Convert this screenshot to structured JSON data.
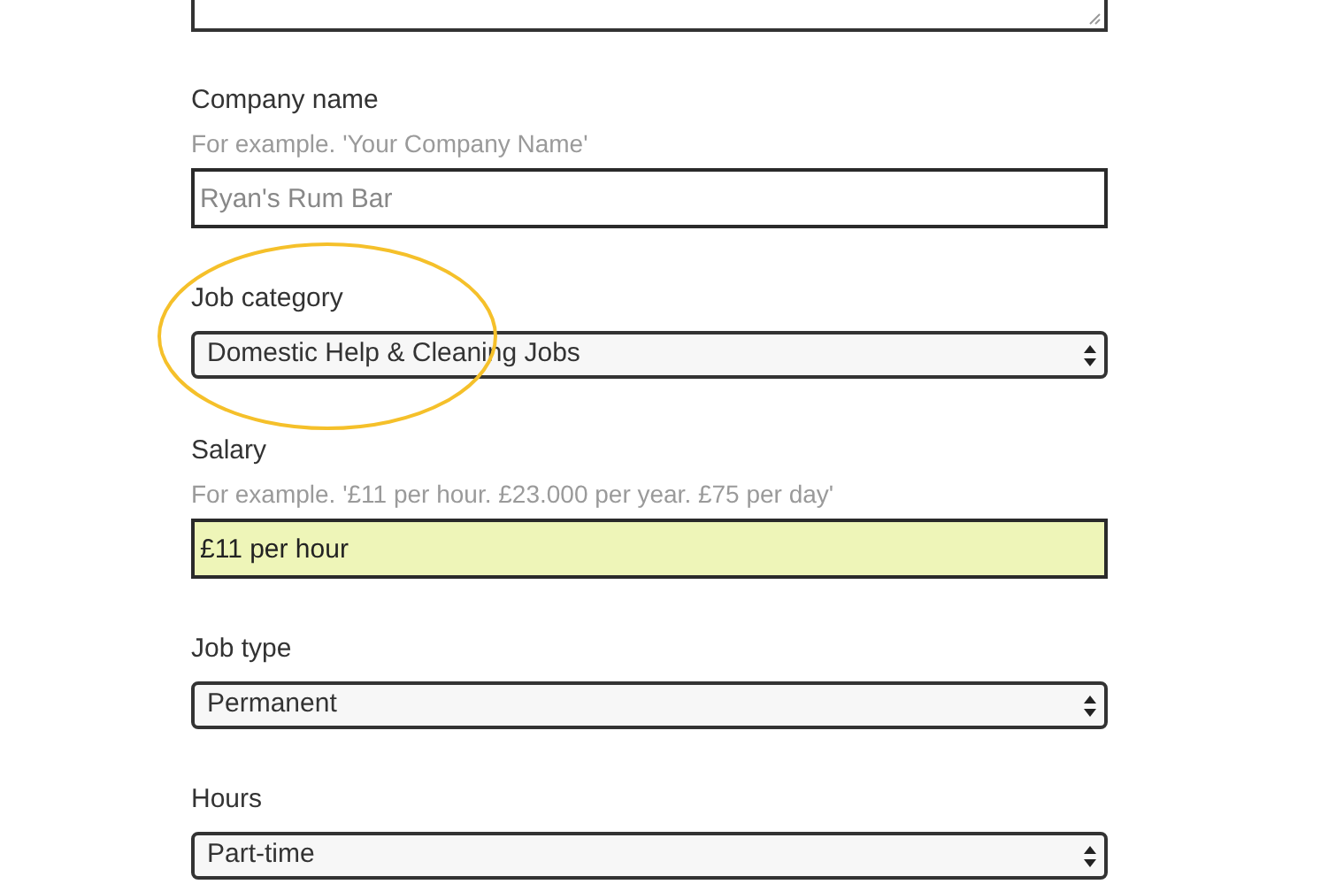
{
  "fields": [
    {
      "kind": "textarea"
    },
    {
      "kind": "text",
      "label": "Company name",
      "hint": "For example. 'Your Company Name'",
      "placeholder": "Ryan's Rum Bar",
      "focused": false
    },
    {
      "kind": "select",
      "label": "Job category",
      "value": "Domestic Help & Cleaning Jobs"
    },
    {
      "kind": "text",
      "label": "Salary",
      "hint": "For example. '£11 per hour. £23.000 per year. £75 per day'",
      "value": "£11 per hour",
      "focused": true
    },
    {
      "kind": "select",
      "label": "Job type",
      "value": "Permanent"
    },
    {
      "kind": "select",
      "label": "Hours",
      "value": "Part-time"
    }
  ]
}
